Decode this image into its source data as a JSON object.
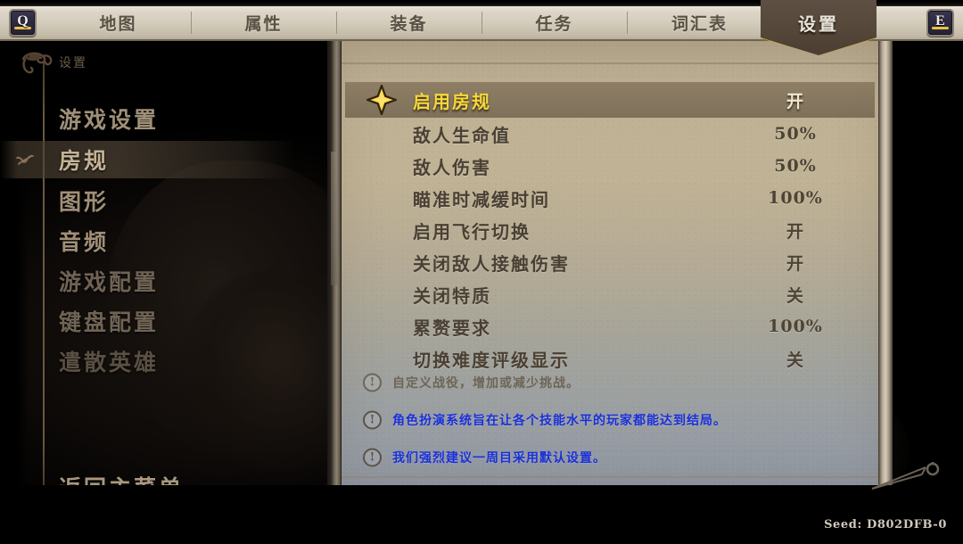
{
  "topbar": {
    "left_key": "Q",
    "right_key": "E",
    "tabs": [
      {
        "label": "地图",
        "active": false
      },
      {
        "label": "属性",
        "active": false
      },
      {
        "label": "装备",
        "active": false
      },
      {
        "label": "任务",
        "active": false
      },
      {
        "label": "词汇表",
        "active": false
      },
      {
        "label": "设置",
        "active": true
      }
    ],
    "active_tab_label": "设置"
  },
  "sidebar": {
    "title": "设置",
    "items": [
      {
        "label": "游戏设置",
        "selected": false,
        "tone": "bright"
      },
      {
        "label": "房规",
        "selected": true,
        "tone": "bright"
      },
      {
        "label": "图形",
        "selected": false,
        "tone": "bright"
      },
      {
        "label": "音频",
        "selected": false,
        "tone": "bright"
      },
      {
        "label": "游戏配置",
        "selected": false,
        "tone": "dim"
      },
      {
        "label": "键盘配置",
        "selected": false,
        "tone": "dim"
      },
      {
        "label": "遣散英雄",
        "selected": false,
        "tone": "dimmer"
      }
    ],
    "back_label": "返回主菜单",
    "ornament_icon": "vine-ornament-icon",
    "selected_mark_icon": "sprout-marker-icon"
  },
  "panel": {
    "header": {
      "icon": "gold-star-icon",
      "label": "启用房规",
      "value": "开"
    },
    "rows": [
      {
        "label": "敌人生命值",
        "value": "50%"
      },
      {
        "label": "敌人伤害",
        "value": "50%"
      },
      {
        "label": "瞄准时减缓时间",
        "value": "100%"
      },
      {
        "label": "启用飞行切换",
        "value": "开"
      },
      {
        "label": "关闭敌人接触伤害",
        "value": "开"
      },
      {
        "label": "关闭特质",
        "value": "关"
      },
      {
        "label": "累赘要求",
        "value": "100%"
      },
      {
        "label": "切换难度评级显示",
        "value": "关"
      }
    ],
    "notes": [
      {
        "icon": "exclamation-icon",
        "text": "自定义战役，增加或减少挑战。",
        "tone": "grey"
      },
      {
        "icon": "exclamation-icon",
        "text": "角色扮演系统旨在让各个技能水平的玩家都能达到结局。",
        "tone": "blue"
      },
      {
        "icon": "exclamation-icon",
        "text": "我们强烈建议一周目采用默认设置。",
        "tone": "blue"
      }
    ]
  },
  "footer": {
    "seed": "Seed: D802DFB-0"
  },
  "colors": {
    "accent_gold": "#f5d83c",
    "banner_border": "#f2c230",
    "note_blue": "#1a30d8",
    "panel_top": "#bfb194",
    "panel_bottom": "#8f96a1",
    "sidebar_selected_text": "#c3b295"
  }
}
